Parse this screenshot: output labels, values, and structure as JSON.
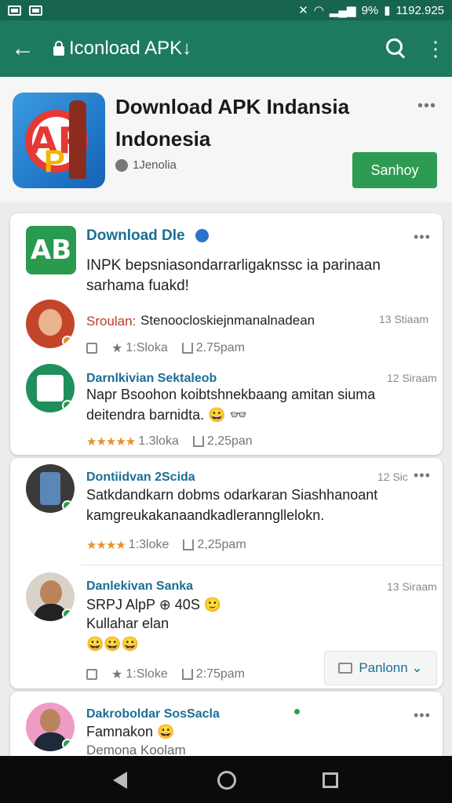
{
  "status": {
    "battery": "9%",
    "time": "1192.925"
  },
  "appbar": {
    "back": "←",
    "title": "Iconload APK↓",
    "more": "⋮"
  },
  "header": {
    "title": "Download APK Indansia Indonesia",
    "developer": "1Jenolia",
    "button": "Sanhoy",
    "more": "•••"
  },
  "post": {
    "name": "Download Dle",
    "text": "INPK bepsniasondarrarligaknssc ia parinaan sarhama fuakd!",
    "more": "•••"
  },
  "comments": [
    {
      "name": "Sroulan:",
      "text": "Stenoocloskiejnmanalnadean",
      "time": "13 Stiaam",
      "likes": "1:Sloka",
      "date": "2.75pam"
    },
    {
      "name": "Darnlkivian Sektaleob",
      "text": "Napr Bsoohon koibtshnekbaang amitan siuma deitendra barnidta. 😀 👓",
      "time": "12 Siraam",
      "stars": "★★★★★",
      "likes": "1.3loka",
      "date": "2,25pan"
    },
    {
      "name": "Dontiidvan 2Scida",
      "text": "Satkdandkarn dobms odarkaran Siashhanoant kamgreukakanaandkadleranngllelokn.",
      "time": "12 Sic",
      "stars": "★★★★",
      "likes": "1:3loke",
      "date": "2,25pam"
    },
    {
      "name": "Danlekivan Sanka",
      "text1": "SRPJ AlpP ⊕ 40S 🙂",
      "text2": "Kullahar elan",
      "emoji": "😀😀😀",
      "time": "13 Siraam",
      "likes": "1:Sloke",
      "date": "2:75pam"
    },
    {
      "name": "Dakroboldar SosSacla",
      "text1": "Famnakon 😀",
      "text2": "Demona Koolam"
    }
  ],
  "reply_button": "Panlonn ⌄",
  "colors": {
    "primary": "#1d7a61",
    "accent": "#2d9c52",
    "link": "#1a6f95"
  }
}
